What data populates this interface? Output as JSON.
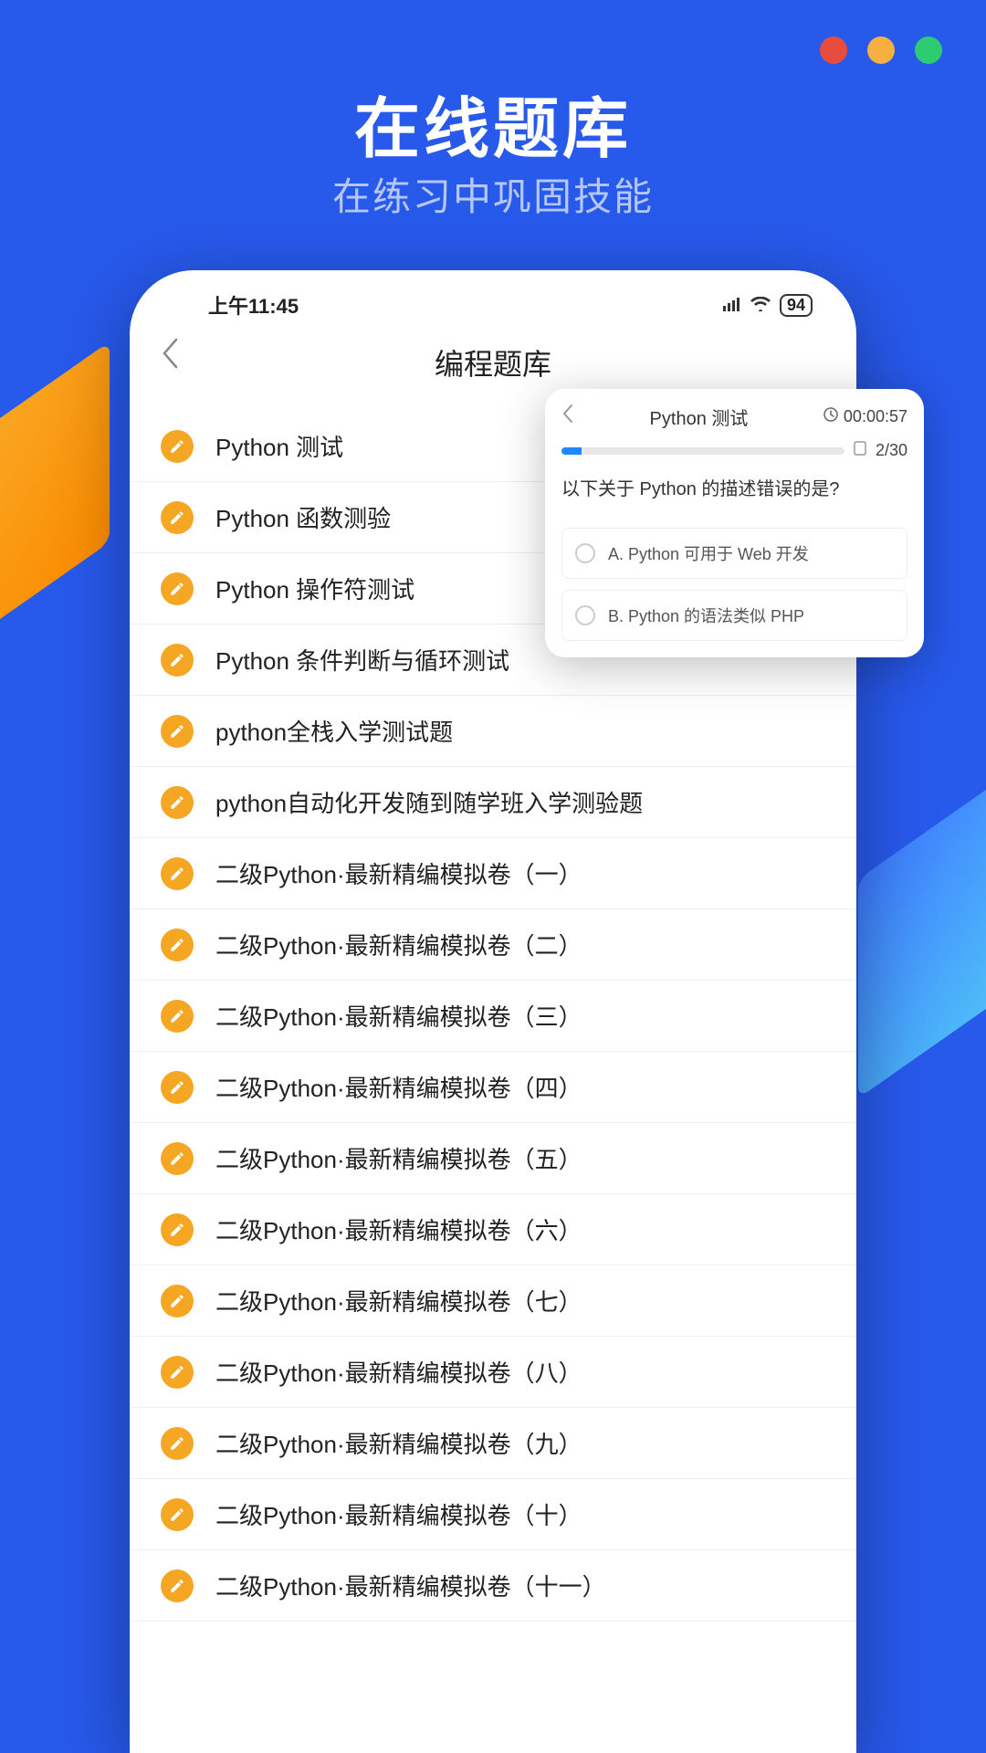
{
  "hero": {
    "title": "在线题库",
    "subtitle": "在练习中巩固技能"
  },
  "status_bar": {
    "time": "上午11:45",
    "battery": "94"
  },
  "app_header": {
    "title": "编程题库"
  },
  "list_items": [
    {
      "label": "Python 测试"
    },
    {
      "label": "Python 函数测验"
    },
    {
      "label": "Python 操作符测试"
    },
    {
      "label": "Python 条件判断与循环测试"
    },
    {
      "label": "python全栈入学测试题"
    },
    {
      "label": "python自动化开发随到随学班入学测验题"
    },
    {
      "label": "二级Python·最新精编模拟卷（一）"
    },
    {
      "label": "二级Python·最新精编模拟卷（二）"
    },
    {
      "label": "二级Python·最新精编模拟卷（三）"
    },
    {
      "label": "二级Python·最新精编模拟卷（四）"
    },
    {
      "label": "二级Python·最新精编模拟卷（五）"
    },
    {
      "label": "二级Python·最新精编模拟卷（六）"
    },
    {
      "label": "二级Python·最新精编模拟卷（七）"
    },
    {
      "label": "二级Python·最新精编模拟卷（八）"
    },
    {
      "label": "二级Python·最新精编模拟卷（九）"
    },
    {
      "label": "二级Python·最新精编模拟卷（十）"
    },
    {
      "label": "二级Python·最新精编模拟卷（十一）"
    }
  ],
  "popup": {
    "title": "Python 测试",
    "timer": "00:00:57",
    "count": "2/30",
    "question": "以下关于 Python 的描述错误的是?",
    "options": [
      {
        "label": "A. Python 可用于 Web 开发"
      },
      {
        "label": "B. Python 的语法类似 PHP"
      }
    ]
  }
}
